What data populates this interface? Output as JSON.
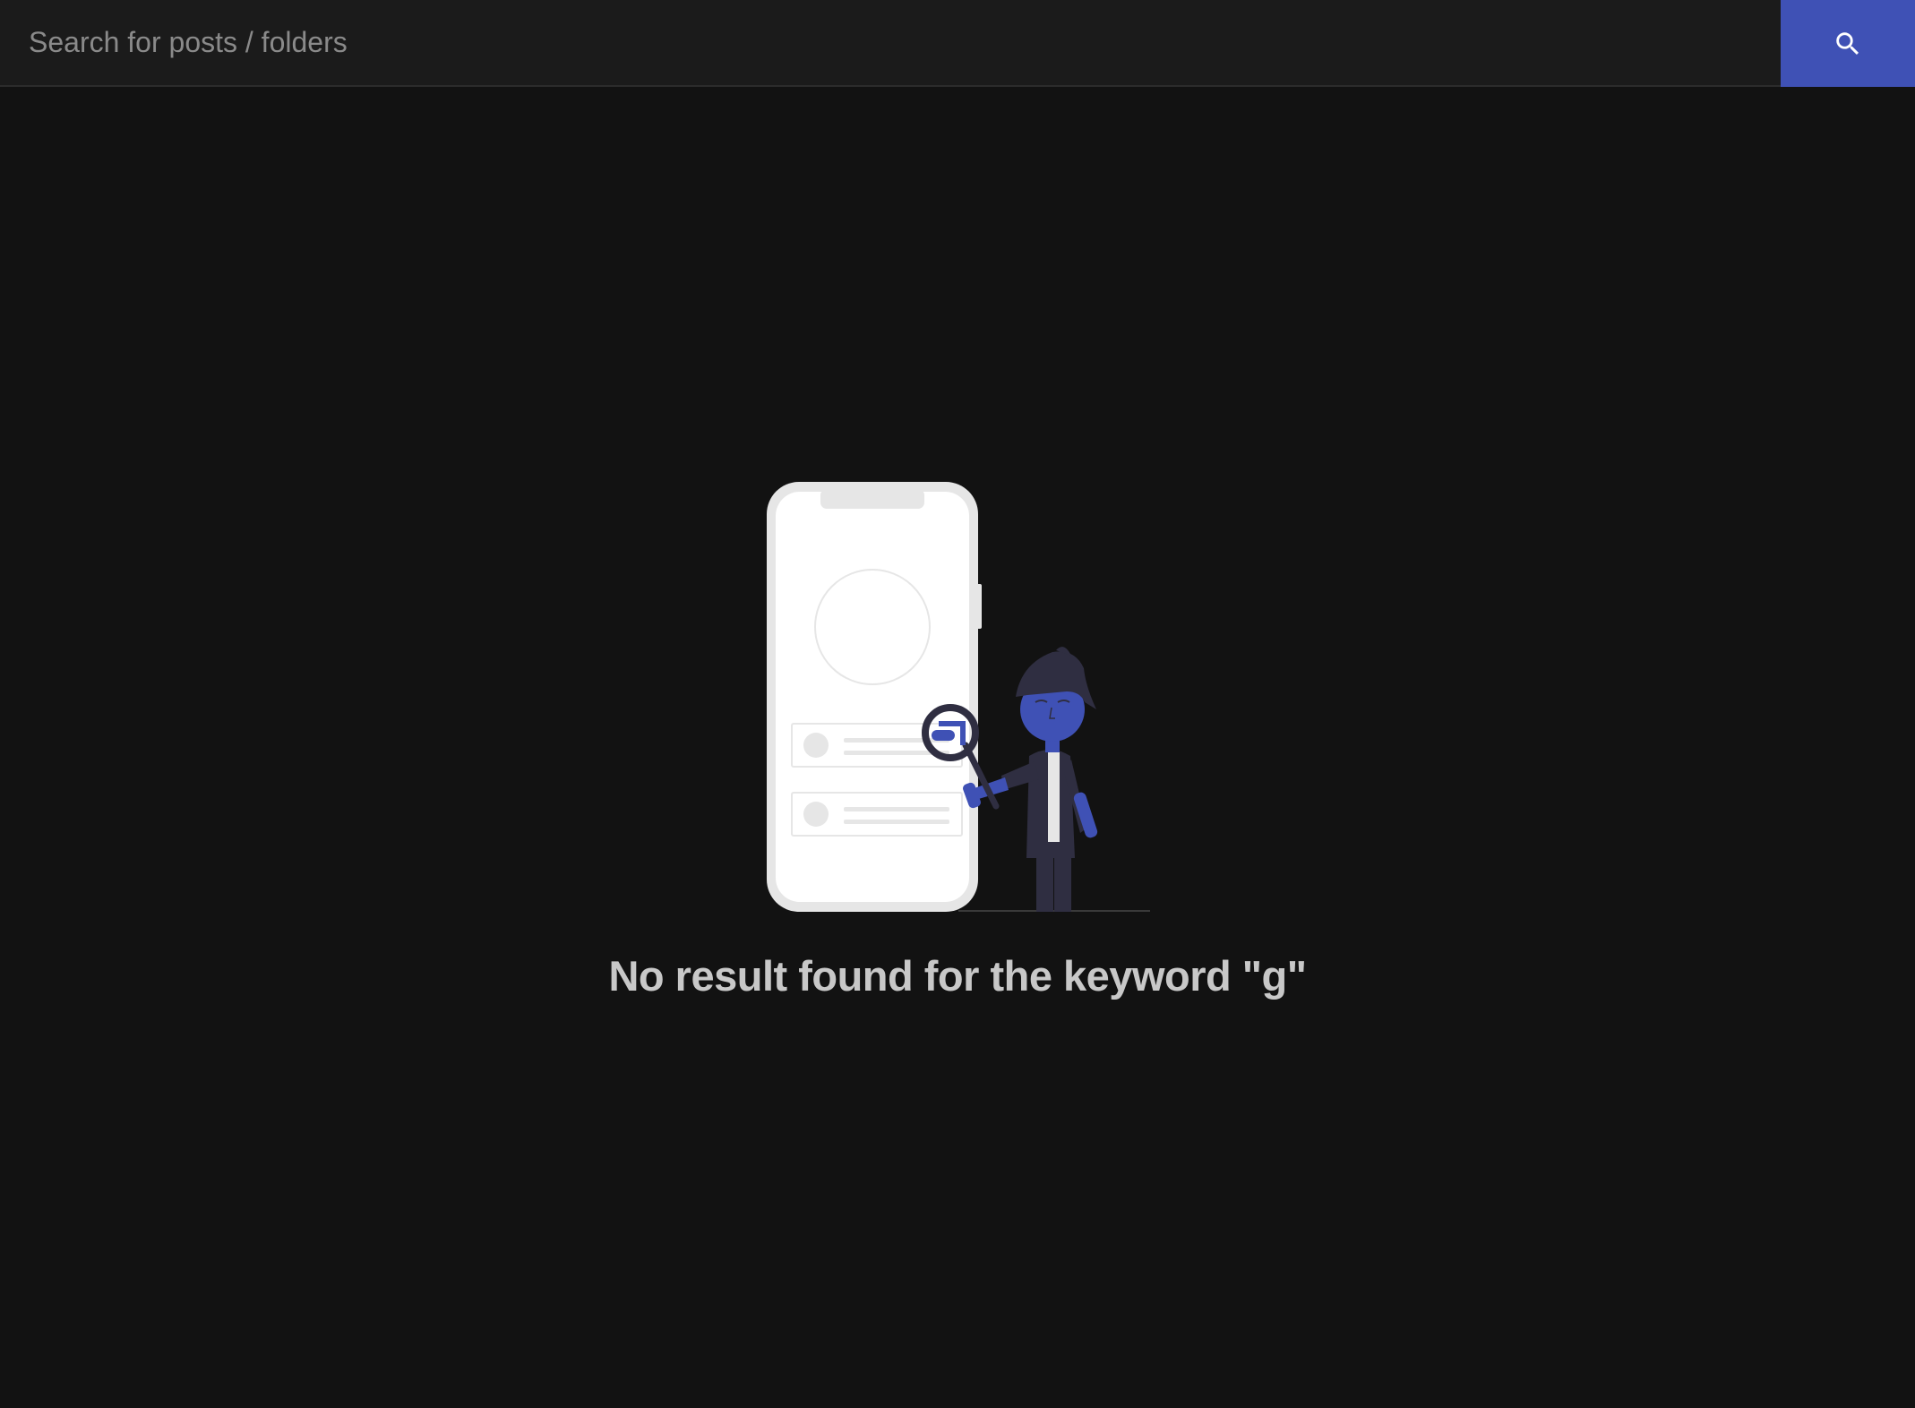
{
  "search": {
    "placeholder": "Search for posts / folders",
    "value": "",
    "button_icon": "search-icon"
  },
  "empty_state": {
    "illustration_icon": "phone-search-illustration",
    "message": "No result found for the keyword \"g\""
  },
  "colors": {
    "background": "#121212",
    "search_bar": "#1b1b1b",
    "accent": "#3f51b5",
    "figure_dark": "#2f2e41",
    "message_text": "#c8c8c8"
  }
}
